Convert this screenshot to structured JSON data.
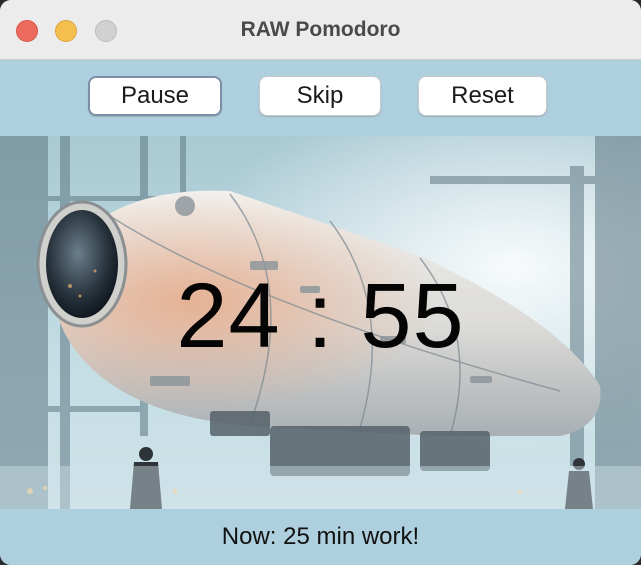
{
  "window": {
    "title": "RAW Pomodoro"
  },
  "controls": {
    "pause_label": "Pause",
    "skip_label": "Skip",
    "reset_label": "Reset"
  },
  "timer": {
    "display": "24 : 55"
  },
  "status": {
    "text": "Now: 25 min work!"
  },
  "colors": {
    "panel": "#aecfdd",
    "titlebar": "#ececec",
    "close": "#ed6a5e",
    "minimize": "#f5bf4f",
    "maximize": "#d1d1d1"
  }
}
